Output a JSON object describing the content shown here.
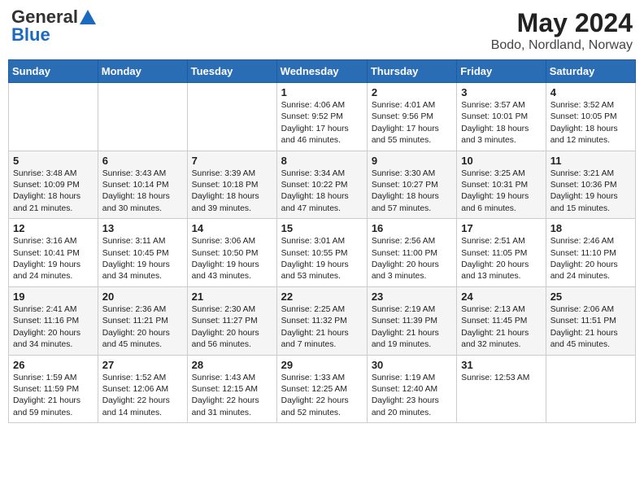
{
  "logo": {
    "general": "General",
    "blue": "Blue"
  },
  "title": "May 2024",
  "subtitle": "Bodo, Nordland, Norway",
  "days_of_week": [
    "Sunday",
    "Monday",
    "Tuesday",
    "Wednesday",
    "Thursday",
    "Friday",
    "Saturday"
  ],
  "weeks": [
    [
      {
        "day": "",
        "info": ""
      },
      {
        "day": "",
        "info": ""
      },
      {
        "day": "",
        "info": ""
      },
      {
        "day": "1",
        "info": "Sunrise: 4:06 AM\nSunset: 9:52 PM\nDaylight: 17 hours and 46 minutes."
      },
      {
        "day": "2",
        "info": "Sunrise: 4:01 AM\nSunset: 9:56 PM\nDaylight: 17 hours and 55 minutes."
      },
      {
        "day": "3",
        "info": "Sunrise: 3:57 AM\nSunset: 10:01 PM\nDaylight: 18 hours and 3 minutes."
      },
      {
        "day": "4",
        "info": "Sunrise: 3:52 AM\nSunset: 10:05 PM\nDaylight: 18 hours and 12 minutes."
      }
    ],
    [
      {
        "day": "5",
        "info": "Sunrise: 3:48 AM\nSunset: 10:09 PM\nDaylight: 18 hours and 21 minutes."
      },
      {
        "day": "6",
        "info": "Sunrise: 3:43 AM\nSunset: 10:14 PM\nDaylight: 18 hours and 30 minutes."
      },
      {
        "day": "7",
        "info": "Sunrise: 3:39 AM\nSunset: 10:18 PM\nDaylight: 18 hours and 39 minutes."
      },
      {
        "day": "8",
        "info": "Sunrise: 3:34 AM\nSunset: 10:22 PM\nDaylight: 18 hours and 47 minutes."
      },
      {
        "day": "9",
        "info": "Sunrise: 3:30 AM\nSunset: 10:27 PM\nDaylight: 18 hours and 57 minutes."
      },
      {
        "day": "10",
        "info": "Sunrise: 3:25 AM\nSunset: 10:31 PM\nDaylight: 19 hours and 6 minutes."
      },
      {
        "day": "11",
        "info": "Sunrise: 3:21 AM\nSunset: 10:36 PM\nDaylight: 19 hours and 15 minutes."
      }
    ],
    [
      {
        "day": "12",
        "info": "Sunrise: 3:16 AM\nSunset: 10:41 PM\nDaylight: 19 hours and 24 minutes."
      },
      {
        "day": "13",
        "info": "Sunrise: 3:11 AM\nSunset: 10:45 PM\nDaylight: 19 hours and 34 minutes."
      },
      {
        "day": "14",
        "info": "Sunrise: 3:06 AM\nSunset: 10:50 PM\nDaylight: 19 hours and 43 minutes."
      },
      {
        "day": "15",
        "info": "Sunrise: 3:01 AM\nSunset: 10:55 PM\nDaylight: 19 hours and 53 minutes."
      },
      {
        "day": "16",
        "info": "Sunrise: 2:56 AM\nSunset: 11:00 PM\nDaylight: 20 hours and 3 minutes."
      },
      {
        "day": "17",
        "info": "Sunrise: 2:51 AM\nSunset: 11:05 PM\nDaylight: 20 hours and 13 minutes."
      },
      {
        "day": "18",
        "info": "Sunrise: 2:46 AM\nSunset: 11:10 PM\nDaylight: 20 hours and 24 minutes."
      }
    ],
    [
      {
        "day": "19",
        "info": "Sunrise: 2:41 AM\nSunset: 11:16 PM\nDaylight: 20 hours and 34 minutes."
      },
      {
        "day": "20",
        "info": "Sunrise: 2:36 AM\nSunset: 11:21 PM\nDaylight: 20 hours and 45 minutes."
      },
      {
        "day": "21",
        "info": "Sunrise: 2:30 AM\nSunset: 11:27 PM\nDaylight: 20 hours and 56 minutes."
      },
      {
        "day": "22",
        "info": "Sunrise: 2:25 AM\nSunset: 11:32 PM\nDaylight: 21 hours and 7 minutes."
      },
      {
        "day": "23",
        "info": "Sunrise: 2:19 AM\nSunset: 11:39 PM\nDaylight: 21 hours and 19 minutes."
      },
      {
        "day": "24",
        "info": "Sunrise: 2:13 AM\nSunset: 11:45 PM\nDaylight: 21 hours and 32 minutes."
      },
      {
        "day": "25",
        "info": "Sunrise: 2:06 AM\nSunset: 11:51 PM\nDaylight: 21 hours and 45 minutes."
      }
    ],
    [
      {
        "day": "26",
        "info": "Sunrise: 1:59 AM\nSunset: 11:59 PM\nDaylight: 21 hours and 59 minutes."
      },
      {
        "day": "27",
        "info": "Sunrise: 1:52 AM\nSunset: 12:06 AM\nDaylight: 22 hours and 14 minutes."
      },
      {
        "day": "28",
        "info": "Sunrise: 1:43 AM\nSunset: 12:15 AM\nDaylight: 22 hours and 31 minutes."
      },
      {
        "day": "29",
        "info": "Sunrise: 1:33 AM\nSunset: 12:25 AM\nDaylight: 22 hours and 52 minutes."
      },
      {
        "day": "30",
        "info": "Sunrise: 1:19 AM\nSunset: 12:40 AM\nDaylight: 23 hours and 20 minutes."
      },
      {
        "day": "31",
        "info": "Sunrise: 12:53 AM"
      },
      {
        "day": "",
        "info": ""
      }
    ]
  ]
}
